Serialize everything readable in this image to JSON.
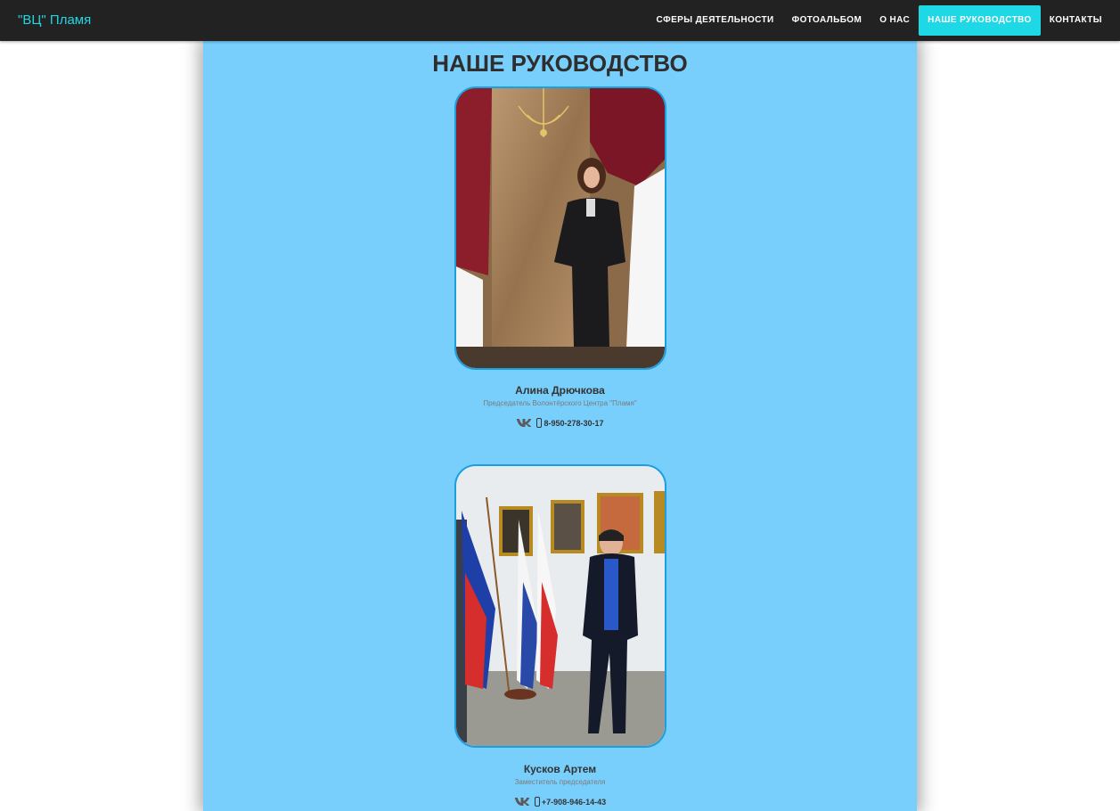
{
  "navbar": {
    "brand": "\"ВЦ\" Пламя",
    "items": [
      {
        "label": "СФЕРЫ ДЕЯТЕЛЬНОСТИ"
      },
      {
        "label": "ФОТОАЛЬБОМ"
      },
      {
        "label": "О НАС"
      },
      {
        "label": "НАШЕ РУКОВОДСТВО",
        "active": true
      },
      {
        "label": "КОНТАКТЫ"
      }
    ]
  },
  "colors": {
    "accent": "#1fd8e6",
    "navbar_bg": "#222222",
    "content_bg": "#79cffc",
    "photo_border": "#1b9fe0"
  },
  "page": {
    "title": "НАШЕ РУКОВОДСТВО"
  },
  "members": [
    {
      "name": "Алина Дрючкова",
      "role": "Председатель Волонтёрского Центра \"Пламя\"",
      "phone": "8-950-278-30-17",
      "icons": [
        "vk-icon",
        "phone-icon"
      ]
    },
    {
      "name": "Кусков Артем",
      "role": "Заместитель председателя",
      "phone": "+7-908-946-14-43",
      "icons": [
        "vk-icon",
        "phone-icon"
      ]
    }
  ]
}
